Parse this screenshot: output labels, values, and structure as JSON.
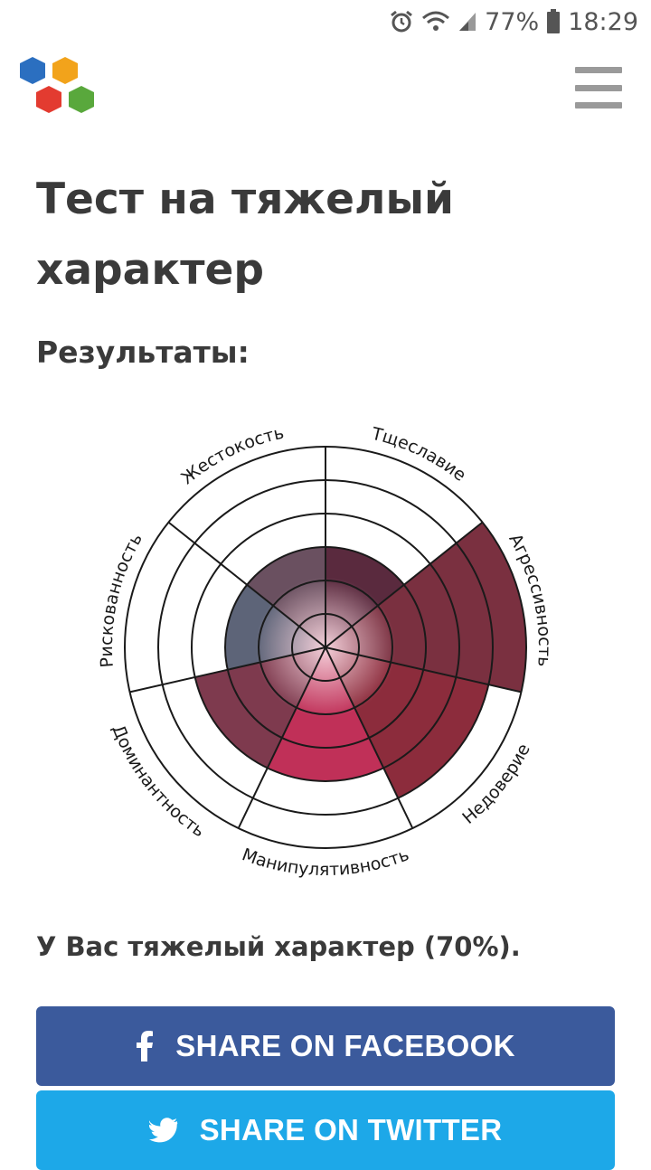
{
  "status_bar": {
    "battery": "77%",
    "time": "18:29"
  },
  "header": {
    "logo_icon": "hexagon-cluster-logo-icon",
    "menu_icon": "hamburger-menu-icon"
  },
  "page": {
    "title": "Тест на тяжелый характер",
    "results_heading": "Результаты:",
    "result_text": "У Вас тяжелый характер (70%)."
  },
  "chart_data": {
    "type": "polar-area",
    "rings": 6,
    "categories": [
      "Тщеславие",
      "Агрессивность",
      "Недоверие",
      "Манипулятивность",
      "Доминантность",
      "Рискованность",
      "Жестокость"
    ],
    "values": [
      3,
      6,
      5,
      4,
      4,
      3,
      3
    ],
    "max": 6,
    "colors": [
      "#5a2a3e",
      "#7a3040",
      "#8c2c3c",
      "#c03058",
      "#7e3a4e",
      "#5d6478",
      "#6a5060"
    ]
  },
  "share": {
    "facebook_label": "SHARE ON FACEBOOK",
    "twitter_label": "SHARE ON TWITTER",
    "facebook_icon": "facebook-icon",
    "twitter_icon": "twitter-icon",
    "facebook_color": "#3b5a9c",
    "twitter_color": "#1da8e8"
  }
}
